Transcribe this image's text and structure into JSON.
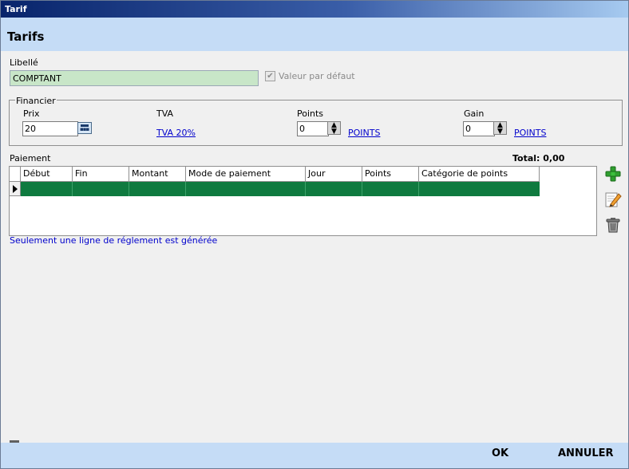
{
  "window": {
    "title": "Tarif"
  },
  "header": {
    "title": "Tarifs"
  },
  "libelle": {
    "label": "Libellé",
    "value": "COMPTANT"
  },
  "default_checkbox": {
    "label": "Valeur par défaut",
    "checked": true
  },
  "financier": {
    "legend": "Financier",
    "prix": {
      "label": "Prix",
      "value": "20"
    },
    "tva": {
      "label": "TVA",
      "link": "TVA 20%"
    },
    "points": {
      "label": "Points",
      "value": "0",
      "link": "POINTS"
    },
    "gain": {
      "label": "Gain",
      "value": "0",
      "link": "POINTS"
    }
  },
  "paiement": {
    "label": "Paiement",
    "total": "Total: 0,00",
    "columns": [
      "Début",
      "Fin",
      "Montant",
      "Mode de paiement",
      "Jour",
      "Points",
      "Catégorie de points"
    ],
    "note": "Seulement une ligne de réglement est générée"
  },
  "footer": {
    "ok_label": "OK",
    "cancel_label": "ANNULER"
  },
  "colors": {
    "header_bg": "#c5dcf6",
    "selected_row": "#0f7a3f",
    "libelle_bg": "#c8e6c8",
    "link": "#0000cc"
  }
}
